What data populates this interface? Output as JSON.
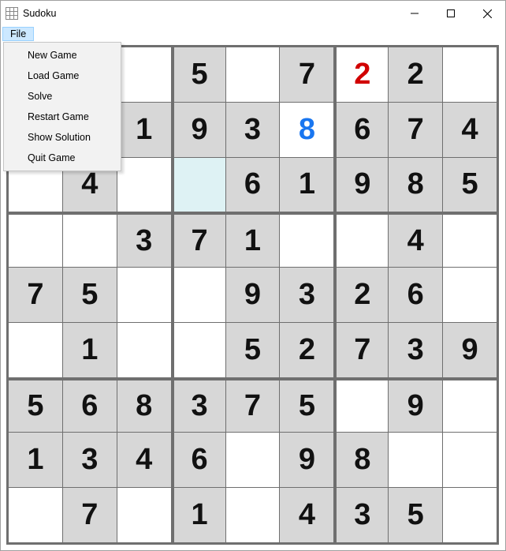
{
  "window": {
    "title": "Sudoku"
  },
  "menu": {
    "top": "File",
    "items": [
      "New Game",
      "Load Game",
      "Solve",
      "Restart Game",
      "Show Solution",
      "Quit Game"
    ]
  },
  "sudoku": {
    "selected": {
      "row": 2,
      "col": 3
    },
    "grid": [
      [
        {
          "v": "",
          "t": "e"
        },
        {
          "v": "",
          "t": "e"
        },
        {
          "v": "",
          "t": "e"
        },
        {
          "v": "5",
          "t": "g"
        },
        {
          "v": "",
          "t": "e"
        },
        {
          "v": "7",
          "t": "g"
        },
        {
          "v": "2",
          "t": "u",
          "c": "red"
        },
        {
          "v": "2",
          "t": "g"
        },
        {
          "v": "",
          "t": "e"
        }
      ],
      [
        {
          "v": "",
          "t": "e"
        },
        {
          "v": "",
          "t": "e"
        },
        {
          "v": "1",
          "t": "g"
        },
        {
          "v": "9",
          "t": "g"
        },
        {
          "v": "3",
          "t": "g"
        },
        {
          "v": "8",
          "t": "u",
          "c": "blue"
        },
        {
          "v": "6",
          "t": "g"
        },
        {
          "v": "7",
          "t": "g"
        },
        {
          "v": "4",
          "t": "g"
        }
      ],
      [
        {
          "v": "",
          "t": "e"
        },
        {
          "v": "4",
          "t": "g"
        },
        {
          "v": "",
          "t": "e"
        },
        {
          "v": "",
          "t": "e"
        },
        {
          "v": "6",
          "t": "g"
        },
        {
          "v": "1",
          "t": "g"
        },
        {
          "v": "9",
          "t": "g"
        },
        {
          "v": "8",
          "t": "g"
        },
        {
          "v": "5",
          "t": "g"
        }
      ],
      [
        {
          "v": "",
          "t": "e"
        },
        {
          "v": "",
          "t": "e"
        },
        {
          "v": "3",
          "t": "g"
        },
        {
          "v": "7",
          "t": "g"
        },
        {
          "v": "1",
          "t": "g"
        },
        {
          "v": "",
          "t": "e"
        },
        {
          "v": "",
          "t": "e"
        },
        {
          "v": "4",
          "t": "g"
        },
        {
          "v": "",
          "t": "e"
        }
      ],
      [
        {
          "v": "7",
          "t": "g"
        },
        {
          "v": "5",
          "t": "g"
        },
        {
          "v": "",
          "t": "e"
        },
        {
          "v": "",
          "t": "e"
        },
        {
          "v": "9",
          "t": "g"
        },
        {
          "v": "3",
          "t": "g"
        },
        {
          "v": "2",
          "t": "g"
        },
        {
          "v": "6",
          "t": "g"
        },
        {
          "v": "",
          "t": "e"
        }
      ],
      [
        {
          "v": "",
          "t": "e"
        },
        {
          "v": "1",
          "t": "g"
        },
        {
          "v": "",
          "t": "e"
        },
        {
          "v": "",
          "t": "e"
        },
        {
          "v": "5",
          "t": "g"
        },
        {
          "v": "2",
          "t": "g"
        },
        {
          "v": "7",
          "t": "g"
        },
        {
          "v": "3",
          "t": "g"
        },
        {
          "v": "9",
          "t": "g"
        }
      ],
      [
        {
          "v": "5",
          "t": "g"
        },
        {
          "v": "6",
          "t": "g"
        },
        {
          "v": "8",
          "t": "g"
        },
        {
          "v": "3",
          "t": "g"
        },
        {
          "v": "7",
          "t": "g"
        },
        {
          "v": "5",
          "t": "g"
        },
        {
          "v": "",
          "t": "e"
        },
        {
          "v": "9",
          "t": "g"
        },
        {
          "v": "",
          "t": "e"
        }
      ],
      [
        {
          "v": "1",
          "t": "g"
        },
        {
          "v": "3",
          "t": "g"
        },
        {
          "v": "4",
          "t": "g"
        },
        {
          "v": "6",
          "t": "g"
        },
        {
          "v": "",
          "t": "e"
        },
        {
          "v": "9",
          "t": "g"
        },
        {
          "v": "8",
          "t": "g"
        },
        {
          "v": "",
          "t": "e"
        },
        {
          "v": "",
          "t": "e"
        }
      ],
      [
        {
          "v": "",
          "t": "e"
        },
        {
          "v": "7",
          "t": "g"
        },
        {
          "v": "",
          "t": "e"
        },
        {
          "v": "1",
          "t": "g"
        },
        {
          "v": "",
          "t": "e"
        },
        {
          "v": "4",
          "t": "g"
        },
        {
          "v": "3",
          "t": "g"
        },
        {
          "v": "5",
          "t": "g"
        },
        {
          "v": "",
          "t": "e"
        }
      ]
    ]
  }
}
